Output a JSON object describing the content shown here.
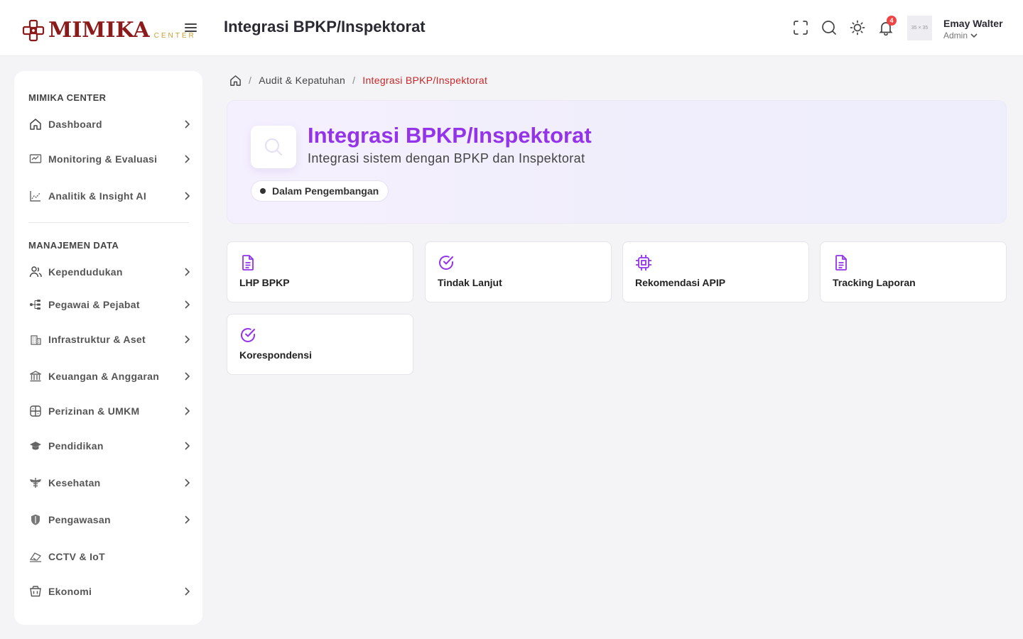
{
  "brand": {
    "name": "MIMIKA",
    "sub": "CENTER",
    "color": "#8b1a1a",
    "accent": "#c9a032"
  },
  "header": {
    "title": "Integrasi BPKP/Inspektorat",
    "notification_count": "4",
    "avatar_placeholder": "35 × 35",
    "user_name": "Emay Walter",
    "user_role": "Admin"
  },
  "sidebar": {
    "section1": "MIMIKA CENTER",
    "section2": "MANAJEMEN DATA",
    "items": [
      {
        "label": "Dashboard",
        "icon": "home-icon"
      },
      {
        "label": "Monitoring & Evaluasi",
        "icon": "monitor-icon"
      },
      {
        "label": "Analitik & Insight AI",
        "icon": "chart-icon"
      },
      {
        "label": "Kependudukan",
        "icon": "users-icon"
      },
      {
        "label": "Pegawai & Pejabat",
        "icon": "org-icon"
      },
      {
        "label": "Infrastruktur & Aset",
        "icon": "building-icon"
      },
      {
        "label": "Keuangan & Anggaran",
        "icon": "bank-icon"
      },
      {
        "label": "Perizinan & UMKM",
        "icon": "license-icon"
      },
      {
        "label": "Pendidikan",
        "icon": "graduation-icon"
      },
      {
        "label": "Kesehatan",
        "icon": "health-icon"
      },
      {
        "label": "Pengawasan",
        "icon": "shield-icon"
      },
      {
        "label": "CCTV & IoT",
        "icon": "camera-icon"
      },
      {
        "label": "Ekonomi",
        "icon": "basket-icon"
      }
    ]
  },
  "breadcrumb": {
    "parent": "Audit & Kepatuhan",
    "current": "Integrasi BPKP/Inspektorat"
  },
  "hero": {
    "title": "Integrasi BPKP/Inspektorat",
    "subtitle": "Integrasi sistem dengan BPKP dan Inspektorat",
    "status": "Dalam Pengembangan",
    "title_color": "#9333ea"
  },
  "cards": [
    {
      "label": "LHP BPKP",
      "icon": "document-icon"
    },
    {
      "label": "Tindak Lanjut",
      "icon": "check-circle-icon"
    },
    {
      "label": "Rekomendasi APIP",
      "icon": "chip-icon"
    },
    {
      "label": "Tracking Laporan",
      "icon": "document-icon"
    },
    {
      "label": "Korespondensi",
      "icon": "check-circle-icon"
    }
  ]
}
